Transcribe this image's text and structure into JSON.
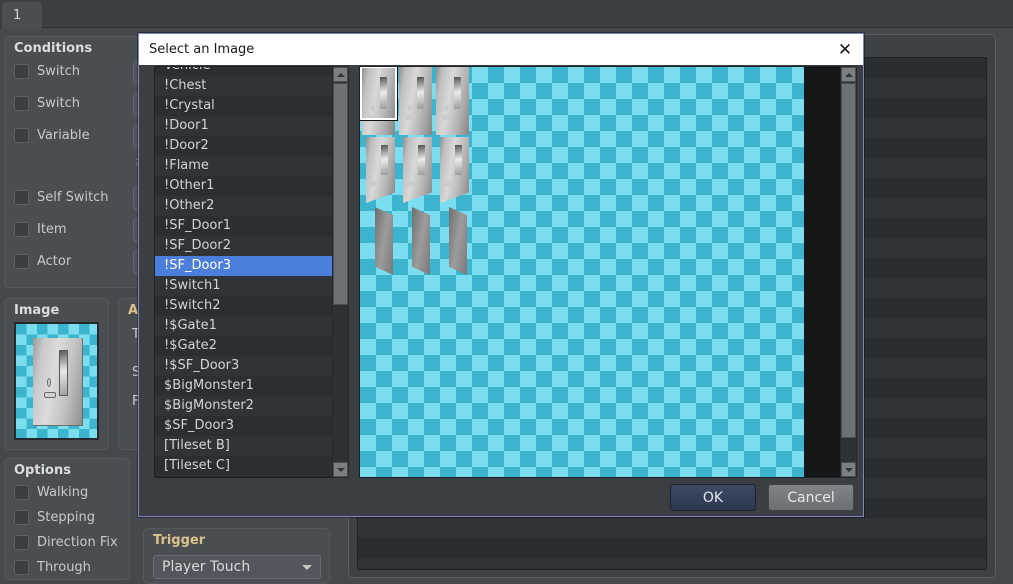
{
  "editor": {
    "tab_label": "1",
    "conditions": {
      "title": "Conditions",
      "items": [
        {
          "label": "Switch"
        },
        {
          "label": "Switch"
        },
        {
          "label": "Variable"
        },
        {
          "label": "Self Switch"
        },
        {
          "label": "Item"
        },
        {
          "label": "Actor"
        }
      ],
      "operator_symbol": "≥"
    },
    "image": {
      "title": "Image"
    },
    "options": {
      "title": "Options",
      "items": [
        {
          "label": "Walking"
        },
        {
          "label": "Stepping"
        },
        {
          "label": "Direction Fix"
        },
        {
          "label": "Through"
        }
      ]
    },
    "autonomous_movement": {
      "title": "Au",
      "labels": [
        "T",
        "S",
        "Fr"
      ]
    },
    "trigger": {
      "title": "Trigger",
      "value": "Player Touch"
    }
  },
  "dialog": {
    "title": "Select an Image",
    "close_icon": "✕",
    "ok_label": "OK",
    "cancel_label": "Cancel",
    "list": {
      "items": [
        "Vehicle",
        "!Chest",
        "!Crystal",
        "!Door1",
        "!Door2",
        "!Flame",
        "!Other1",
        "!Other2",
        "!SF_Door1",
        "!SF_Door2",
        "!SF_Door3",
        "!Switch1",
        "!Switch2",
        "!$Gate1",
        "!$Gate2",
        "!$SF_Door3",
        "$BigMonster1",
        "$BigMonster2",
        "$SF_Door3",
        "[Tileset B]",
        "[Tileset C]"
      ],
      "selected": "!SF_Door3",
      "selected_index": 10,
      "scroll_up_icon": "scroll-up-arrow-icon",
      "scroll_down_icon": "scroll-down-arrow-icon"
    },
    "preview": {
      "selected_cell_row": 0,
      "selected_cell_col": 0,
      "columns": 3,
      "rows": 3,
      "checker_color_light": "#7bdef0",
      "checker_color_dark": "#3cb4ce"
    }
  },
  "colors": {
    "accent": "#4b7fdb",
    "dialog_border": "#7b86c6",
    "panel_bg": "#4a4d52",
    "window_bg": "#45484d",
    "list_bg": "#26292d"
  }
}
